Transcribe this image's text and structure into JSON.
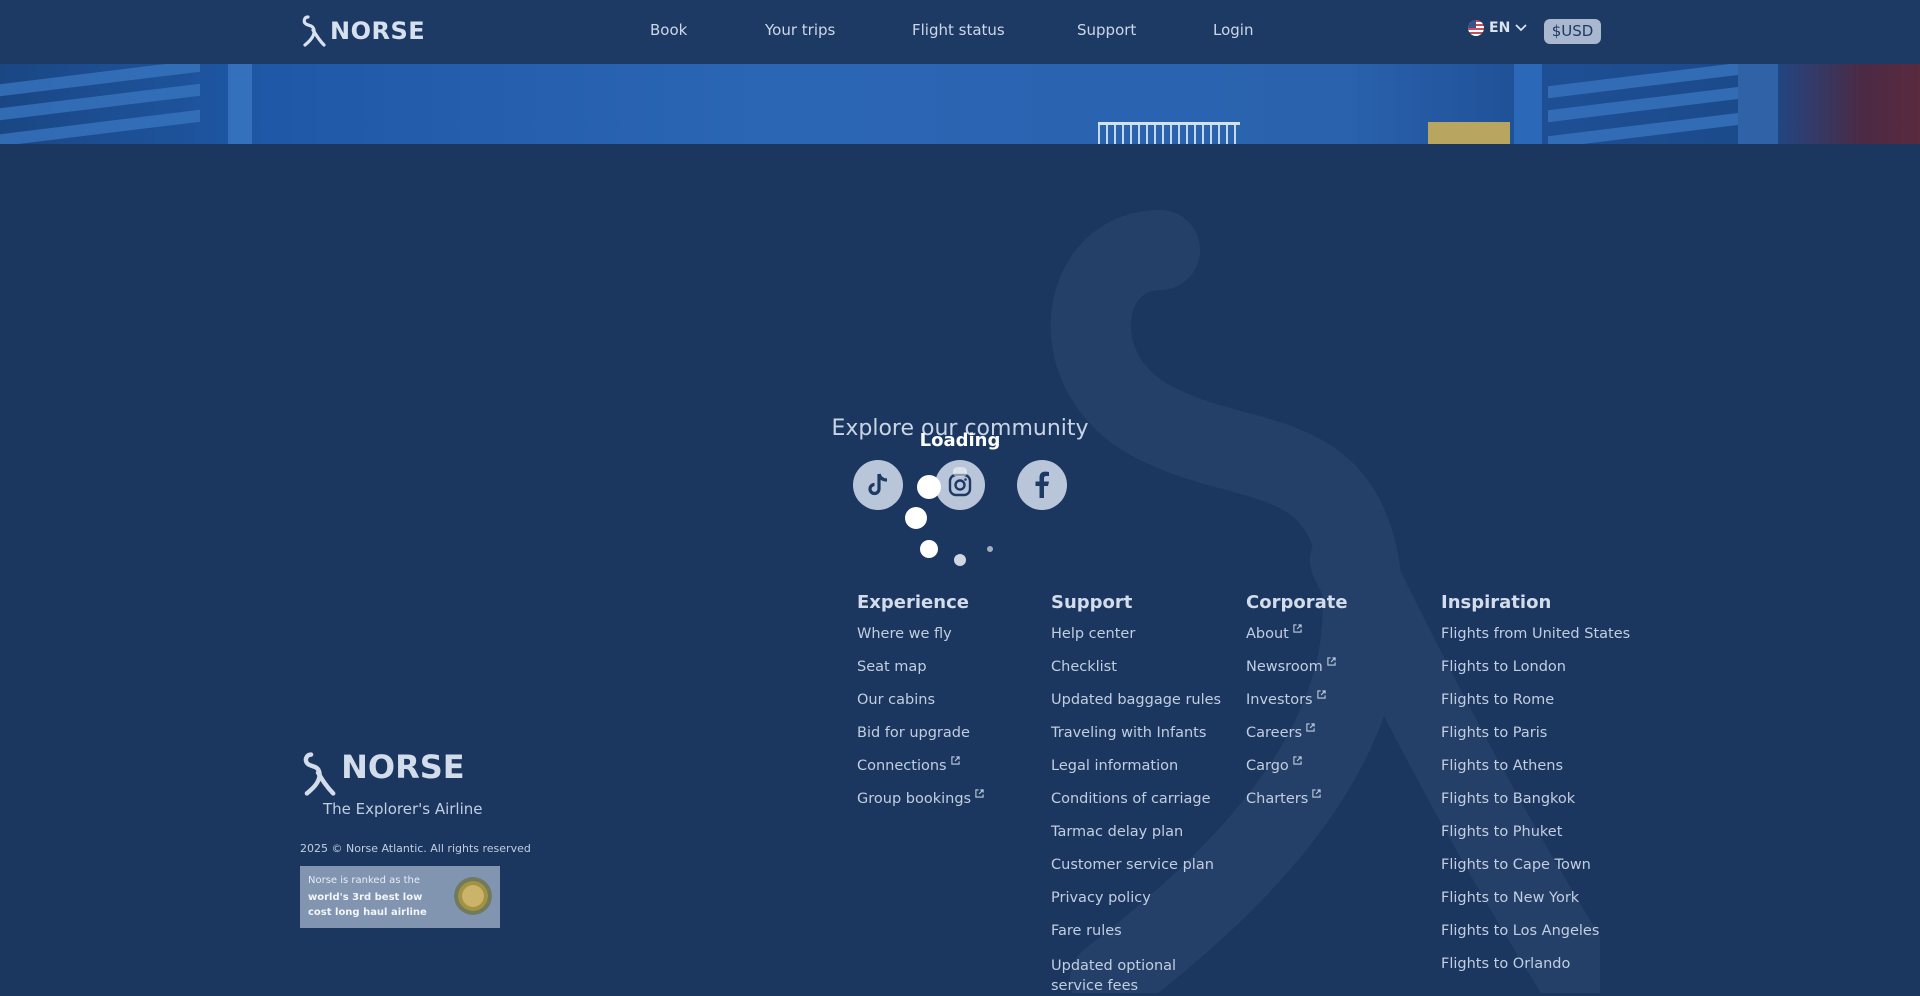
{
  "header": {
    "brand": "NORSE",
    "nav": [
      "Book",
      "Your trips",
      "Flight status",
      "Support",
      "Login"
    ],
    "language": "EN",
    "currency": "$USD"
  },
  "community": {
    "title": "Explore our community",
    "loading": "Loading",
    "socials": [
      "tiktok-icon",
      "instagram-icon",
      "facebook-icon"
    ]
  },
  "footer": {
    "columns": [
      {
        "heading": "Experience",
        "links": [
          "Where we fly",
          "Seat map",
          "Our cabins",
          "Bid for upgrade",
          "Connections",
          "Group bookings"
        ]
      },
      {
        "heading": "Support",
        "links": [
          "Help center",
          "Checklist",
          "Updated baggage rules",
          "Traveling with Infants",
          "Legal information",
          "Conditions of carriage",
          "Tarmac delay plan",
          "Customer service plan",
          "Privacy policy",
          "Fare rules",
          "Updated optional service fees"
        ]
      },
      {
        "heading": "Corporate",
        "links": [
          "About",
          "Newsroom",
          "Investors",
          "Careers",
          "Cargo",
          "Charters"
        ]
      },
      {
        "heading": "Inspiration",
        "links": [
          "Flights from United States",
          "Flights to London",
          "Flights to Rome",
          "Flights to Paris",
          "Flights to Athens",
          "Flights to Bangkok",
          "Flights to Phuket",
          "Flights to Cape Town",
          "Flights to New York",
          "Flights to Los Angeles",
          "Flights to Orlando"
        ]
      }
    ],
    "brand": "NORSE",
    "tagline": "The Explorer's Airline",
    "copyright": "2025 © Norse Atlantic. All rights reserved",
    "award": {
      "line1": "Norse is ranked as the",
      "line2": "world's 3rd best low cost long haul airline"
    }
  },
  "colors": {
    "background": "#1b3760",
    "header": "#1d3a64",
    "currency_pill": "#a9b8cf",
    "social_circle": "#b9c6d9"
  }
}
